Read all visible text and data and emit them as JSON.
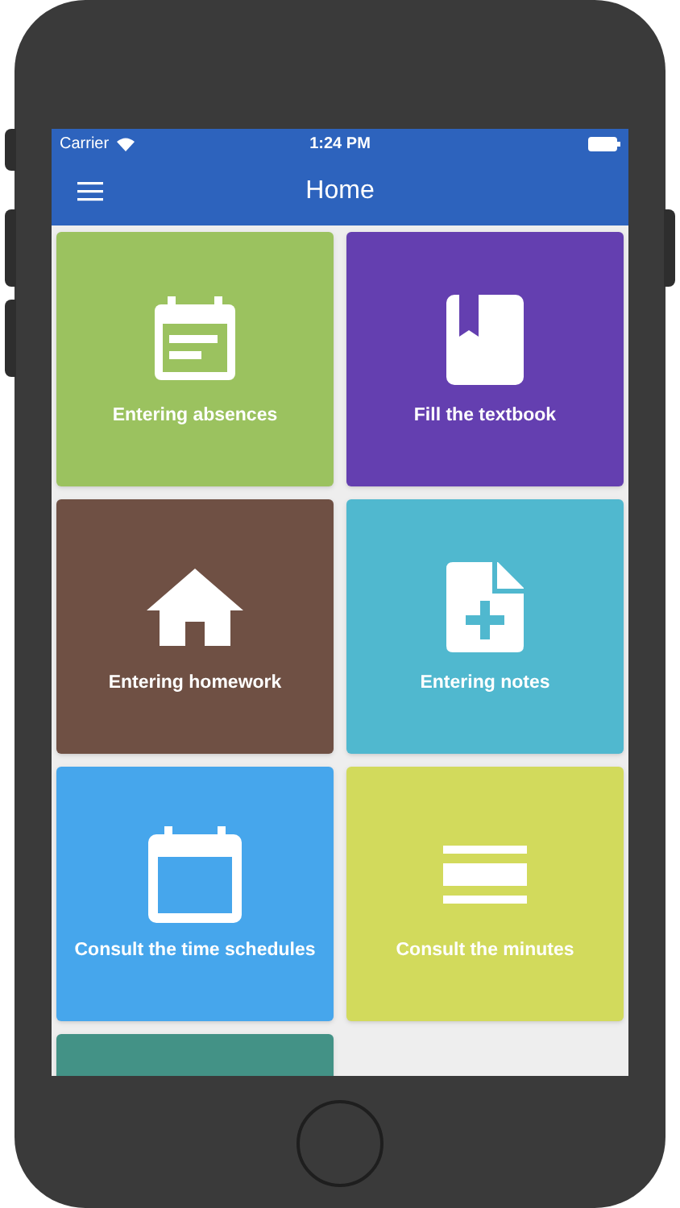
{
  "status_bar": {
    "carrier": "Carrier",
    "time": "1:24 PM"
  },
  "nav_bar": {
    "title": "Home"
  },
  "tiles": [
    {
      "label": "Entering absences",
      "kind": "calendar-lines",
      "color": "#9bc25f"
    },
    {
      "label": "Fill the textbook",
      "kind": "book",
      "color": "#643fb0"
    },
    {
      "label": "Entering homework",
      "kind": "house",
      "color": "#6f5044"
    },
    {
      "label": "Entering notes",
      "kind": "note-plus",
      "color": "#50b8cf"
    },
    {
      "label": "Consult the time schedules",
      "kind": "calendar",
      "color": "#46a6ec"
    },
    {
      "label": "Consult the minutes",
      "kind": "lines",
      "color": "#d2da5c"
    },
    {
      "kind": "none",
      "color": "#439286"
    }
  ]
}
